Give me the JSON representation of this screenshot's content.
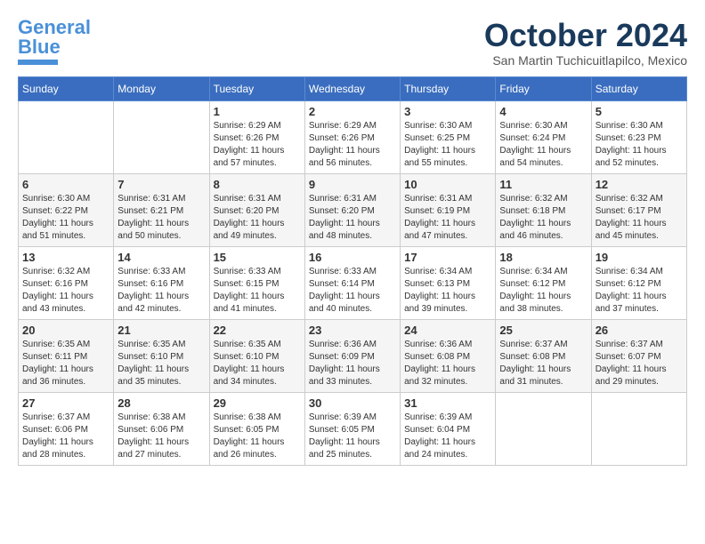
{
  "logo": {
    "text1": "General",
    "text2": "Blue"
  },
  "title": "October 2024",
  "location": "San Martin Tuchicuitlapilco, Mexico",
  "days_of_week": [
    "Sunday",
    "Monday",
    "Tuesday",
    "Wednesday",
    "Thursday",
    "Friday",
    "Saturday"
  ],
  "weeks": [
    [
      {
        "day": "",
        "info": ""
      },
      {
        "day": "",
        "info": ""
      },
      {
        "day": "1",
        "info": "Sunrise: 6:29 AM\nSunset: 6:26 PM\nDaylight: 11 hours and 57 minutes."
      },
      {
        "day": "2",
        "info": "Sunrise: 6:29 AM\nSunset: 6:26 PM\nDaylight: 11 hours and 56 minutes."
      },
      {
        "day": "3",
        "info": "Sunrise: 6:30 AM\nSunset: 6:25 PM\nDaylight: 11 hours and 55 minutes."
      },
      {
        "day": "4",
        "info": "Sunrise: 6:30 AM\nSunset: 6:24 PM\nDaylight: 11 hours and 54 minutes."
      },
      {
        "day": "5",
        "info": "Sunrise: 6:30 AM\nSunset: 6:23 PM\nDaylight: 11 hours and 52 minutes."
      }
    ],
    [
      {
        "day": "6",
        "info": "Sunrise: 6:30 AM\nSunset: 6:22 PM\nDaylight: 11 hours and 51 minutes."
      },
      {
        "day": "7",
        "info": "Sunrise: 6:31 AM\nSunset: 6:21 PM\nDaylight: 11 hours and 50 minutes."
      },
      {
        "day": "8",
        "info": "Sunrise: 6:31 AM\nSunset: 6:20 PM\nDaylight: 11 hours and 49 minutes."
      },
      {
        "day": "9",
        "info": "Sunrise: 6:31 AM\nSunset: 6:20 PM\nDaylight: 11 hours and 48 minutes."
      },
      {
        "day": "10",
        "info": "Sunrise: 6:31 AM\nSunset: 6:19 PM\nDaylight: 11 hours and 47 minutes."
      },
      {
        "day": "11",
        "info": "Sunrise: 6:32 AM\nSunset: 6:18 PM\nDaylight: 11 hours and 46 minutes."
      },
      {
        "day": "12",
        "info": "Sunrise: 6:32 AM\nSunset: 6:17 PM\nDaylight: 11 hours and 45 minutes."
      }
    ],
    [
      {
        "day": "13",
        "info": "Sunrise: 6:32 AM\nSunset: 6:16 PM\nDaylight: 11 hours and 43 minutes."
      },
      {
        "day": "14",
        "info": "Sunrise: 6:33 AM\nSunset: 6:16 PM\nDaylight: 11 hours and 42 minutes."
      },
      {
        "day": "15",
        "info": "Sunrise: 6:33 AM\nSunset: 6:15 PM\nDaylight: 11 hours and 41 minutes."
      },
      {
        "day": "16",
        "info": "Sunrise: 6:33 AM\nSunset: 6:14 PM\nDaylight: 11 hours and 40 minutes."
      },
      {
        "day": "17",
        "info": "Sunrise: 6:34 AM\nSunset: 6:13 PM\nDaylight: 11 hours and 39 minutes."
      },
      {
        "day": "18",
        "info": "Sunrise: 6:34 AM\nSunset: 6:12 PM\nDaylight: 11 hours and 38 minutes."
      },
      {
        "day": "19",
        "info": "Sunrise: 6:34 AM\nSunset: 6:12 PM\nDaylight: 11 hours and 37 minutes."
      }
    ],
    [
      {
        "day": "20",
        "info": "Sunrise: 6:35 AM\nSunset: 6:11 PM\nDaylight: 11 hours and 36 minutes."
      },
      {
        "day": "21",
        "info": "Sunrise: 6:35 AM\nSunset: 6:10 PM\nDaylight: 11 hours and 35 minutes."
      },
      {
        "day": "22",
        "info": "Sunrise: 6:35 AM\nSunset: 6:10 PM\nDaylight: 11 hours and 34 minutes."
      },
      {
        "day": "23",
        "info": "Sunrise: 6:36 AM\nSunset: 6:09 PM\nDaylight: 11 hours and 33 minutes."
      },
      {
        "day": "24",
        "info": "Sunrise: 6:36 AM\nSunset: 6:08 PM\nDaylight: 11 hours and 32 minutes."
      },
      {
        "day": "25",
        "info": "Sunrise: 6:37 AM\nSunset: 6:08 PM\nDaylight: 11 hours and 31 minutes."
      },
      {
        "day": "26",
        "info": "Sunrise: 6:37 AM\nSunset: 6:07 PM\nDaylight: 11 hours and 29 minutes."
      }
    ],
    [
      {
        "day": "27",
        "info": "Sunrise: 6:37 AM\nSunset: 6:06 PM\nDaylight: 11 hours and 28 minutes."
      },
      {
        "day": "28",
        "info": "Sunrise: 6:38 AM\nSunset: 6:06 PM\nDaylight: 11 hours and 27 minutes."
      },
      {
        "day": "29",
        "info": "Sunrise: 6:38 AM\nSunset: 6:05 PM\nDaylight: 11 hours and 26 minutes."
      },
      {
        "day": "30",
        "info": "Sunrise: 6:39 AM\nSunset: 6:05 PM\nDaylight: 11 hours and 25 minutes."
      },
      {
        "day": "31",
        "info": "Sunrise: 6:39 AM\nSunset: 6:04 PM\nDaylight: 11 hours and 24 minutes."
      },
      {
        "day": "",
        "info": ""
      },
      {
        "day": "",
        "info": ""
      }
    ]
  ]
}
